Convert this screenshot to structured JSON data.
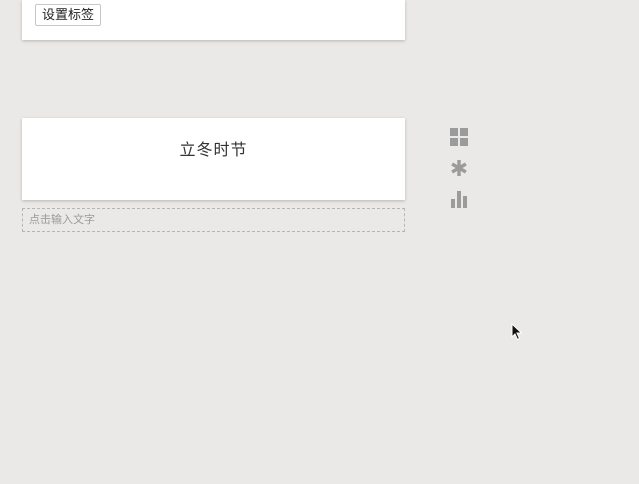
{
  "top_card": {
    "tag_button_label": "设置标签"
  },
  "main_card": {
    "title": "立冬时节"
  },
  "text_input": {
    "placeholder": "点击输入文字"
  },
  "toolbar": {
    "tools": [
      "grid-icon",
      "asterisk-icon",
      "bar-chart-icon"
    ],
    "icon_color": "#9b9b9b"
  },
  "colors": {
    "background": "#ebe9e7",
    "card": "#ffffff"
  }
}
